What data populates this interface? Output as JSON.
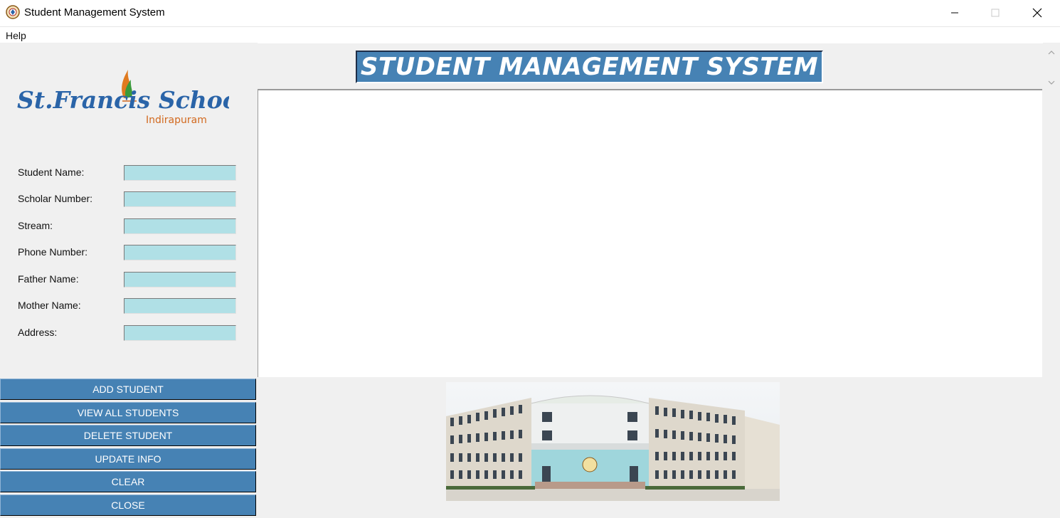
{
  "window": {
    "title": "Student Management System",
    "icon": "school-emblem-icon"
  },
  "menu": {
    "items": [
      {
        "label": "Help"
      }
    ]
  },
  "logo": {
    "name": "St.Francis School",
    "location": "Indirapuram"
  },
  "form": {
    "fields": [
      {
        "label": "Student Name:",
        "value": ""
      },
      {
        "label": "Scholar Number:",
        "value": ""
      },
      {
        "label": "Stream:",
        "value": ""
      },
      {
        "label": "Phone Number:",
        "value": ""
      },
      {
        "label": "Father Name:",
        "value": ""
      },
      {
        "label": "Mother Name:",
        "value": ""
      },
      {
        "label": "Address:",
        "value": ""
      }
    ]
  },
  "actions": [
    {
      "label": "ADD STUDENT"
    },
    {
      "label": "VIEW ALL STUDENTS"
    },
    {
      "label": "DELETE STUDENT"
    },
    {
      "label": "UPDATE INFO"
    },
    {
      "label": "CLEAR"
    },
    {
      "label": "CLOSE"
    }
  ],
  "header": {
    "title": "STUDENT MANAGEMENT SYSTEM"
  },
  "colors": {
    "button_bg": "#4682b4",
    "field_bg": "#b0e0e6",
    "logo_blue": "#2a64a8",
    "logo_orange": "#d2691e"
  }
}
